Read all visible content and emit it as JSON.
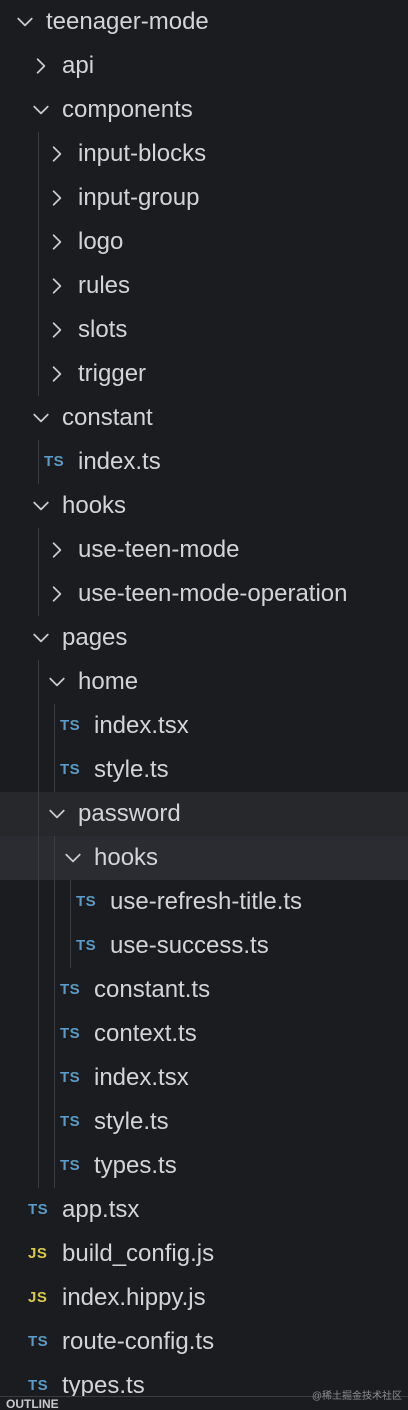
{
  "explorer": {
    "rows": [
      {
        "type": "folder",
        "open": true,
        "depth": 0,
        "label": "teenager-mode",
        "name": "folder-teenager-mode"
      },
      {
        "type": "folder",
        "open": false,
        "depth": 1,
        "label": "api",
        "name": "folder-api"
      },
      {
        "type": "folder",
        "open": true,
        "depth": 1,
        "label": "components",
        "name": "folder-components"
      },
      {
        "type": "folder",
        "open": false,
        "depth": 2,
        "label": "input-blocks",
        "name": "folder-input-blocks"
      },
      {
        "type": "folder",
        "open": false,
        "depth": 2,
        "label": "input-group",
        "name": "folder-input-group"
      },
      {
        "type": "folder",
        "open": false,
        "depth": 2,
        "label": "logo",
        "name": "folder-logo"
      },
      {
        "type": "folder",
        "open": false,
        "depth": 2,
        "label": "rules",
        "name": "folder-rules"
      },
      {
        "type": "folder",
        "open": false,
        "depth": 2,
        "label": "slots",
        "name": "folder-slots"
      },
      {
        "type": "folder",
        "open": false,
        "depth": 2,
        "label": "trigger",
        "name": "folder-trigger"
      },
      {
        "type": "folder",
        "open": true,
        "depth": 1,
        "label": "constant",
        "name": "folder-constant"
      },
      {
        "type": "file",
        "icon": "TS",
        "depth": 2,
        "label": "index.ts",
        "name": "file-constant-index-ts"
      },
      {
        "type": "folder",
        "open": true,
        "depth": 1,
        "label": "hooks",
        "name": "folder-hooks"
      },
      {
        "type": "folder",
        "open": false,
        "depth": 2,
        "label": "use-teen-mode",
        "name": "folder-use-teen-mode"
      },
      {
        "type": "folder",
        "open": false,
        "depth": 2,
        "label": "use-teen-mode-operation",
        "name": "folder-use-teen-mode-operation"
      },
      {
        "type": "folder",
        "open": true,
        "depth": 1,
        "label": "pages",
        "name": "folder-pages"
      },
      {
        "type": "folder",
        "open": true,
        "depth": 2,
        "label": "home",
        "name": "folder-home"
      },
      {
        "type": "file",
        "icon": "TS",
        "depth": 3,
        "label": "index.tsx",
        "name": "file-home-index-tsx"
      },
      {
        "type": "file",
        "icon": "TS",
        "depth": 3,
        "label": "style.ts",
        "name": "file-home-style-ts"
      },
      {
        "type": "folder",
        "open": true,
        "depth": 2,
        "label": "password",
        "name": "folder-password",
        "state": "hover"
      },
      {
        "type": "folder",
        "open": true,
        "depth": 3,
        "label": "hooks",
        "name": "folder-password-hooks",
        "state": "selected"
      },
      {
        "type": "file",
        "icon": "TS",
        "depth": 4,
        "label": "use-refresh-title.ts",
        "name": "file-use-refresh-title-ts"
      },
      {
        "type": "file",
        "icon": "TS",
        "depth": 4,
        "label": "use-success.ts",
        "name": "file-use-success-ts"
      },
      {
        "type": "file",
        "icon": "TS",
        "depth": 3,
        "label": "constant.ts",
        "name": "file-password-constant-ts"
      },
      {
        "type": "file",
        "icon": "TS",
        "depth": 3,
        "label": "context.ts",
        "name": "file-password-context-ts"
      },
      {
        "type": "file",
        "icon": "TS",
        "depth": 3,
        "label": "index.tsx",
        "name": "file-password-index-tsx"
      },
      {
        "type": "file",
        "icon": "TS",
        "depth": 3,
        "label": "style.ts",
        "name": "file-password-style-ts"
      },
      {
        "type": "file",
        "icon": "TS",
        "depth": 3,
        "label": "types.ts",
        "name": "file-password-types-ts"
      },
      {
        "type": "file",
        "icon": "TS",
        "depth": 1,
        "label": "app.tsx",
        "name": "file-app-tsx"
      },
      {
        "type": "file",
        "icon": "JS",
        "depth": 1,
        "label": "build_config.js",
        "name": "file-build-config-js"
      },
      {
        "type": "file",
        "icon": "JS",
        "depth": 1,
        "label": "index.hippy.js",
        "name": "file-index-hippy-js"
      },
      {
        "type": "file",
        "icon": "TS",
        "depth": 1,
        "label": "route-config.ts",
        "name": "file-route-config-ts"
      },
      {
        "type": "file",
        "icon": "TS",
        "depth": 1,
        "label": "types.ts",
        "name": "file-types-ts"
      }
    ]
  },
  "outline": {
    "label": "OUTLINE"
  },
  "watermark": {
    "text": "@稀土掘金技术社区"
  },
  "colors": {
    "ts_icon": "#5a9bc7",
    "js_icon": "#d6c94b",
    "text": "#d2d4d8",
    "background": "#1b1c1f"
  }
}
